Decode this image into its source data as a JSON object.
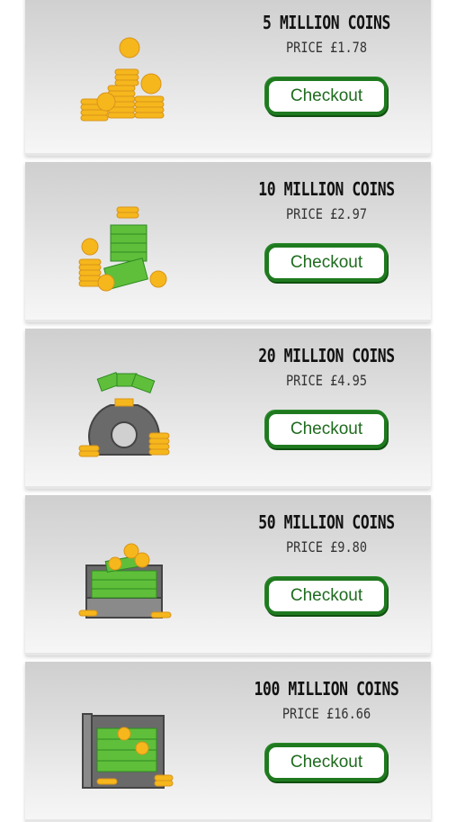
{
  "packages": [
    {
      "title": "5 MILLION COINS",
      "price": "PRICE £1.78",
      "button": "Checkout",
      "icon": "coin-stack-icon"
    },
    {
      "title": "10 MILLION COINS",
      "price": "PRICE £2.97",
      "button": "Checkout",
      "icon": "coins-and-cash-icon"
    },
    {
      "title": "20 MILLION COINS",
      "price": "PRICE £4.95",
      "button": "Checkout",
      "icon": "money-bag-icon"
    },
    {
      "title": "50 MILLION COINS",
      "price": "PRICE £9.80",
      "button": "Checkout",
      "icon": "money-briefcase-icon"
    },
    {
      "title": "100 MILLION COINS",
      "price": "PRICE £16.66",
      "button": "Checkout",
      "icon": "money-safe-icon"
    }
  ],
  "colors": {
    "accent": "#1f7a1f",
    "coin": "#f5b71c",
    "cash": "#5fbf3a"
  }
}
